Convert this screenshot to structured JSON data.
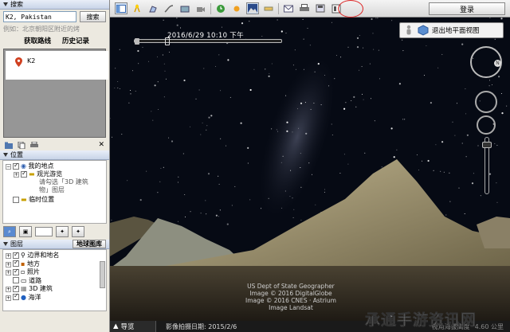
{
  "search": {
    "header": "搜索",
    "input_value": "K2, Pakistan",
    "search_button": "搜索",
    "example": "例如：北京朝阳区附近的烤",
    "get_route": "获取路线",
    "history": "历史记录",
    "result_label": "K2"
  },
  "places": {
    "header": "位置",
    "my_places": "我的地点",
    "sightseeing": "观光游览",
    "note_line1": "请勾选「3D 建筑",
    "note_line2": "物」图层",
    "temp_places": "临时位置"
  },
  "layers": {
    "header": "图层",
    "gallery_button": "地球图库",
    "items": [
      "边界和地名",
      "地方",
      "照片",
      "道路",
      "3D 建筑",
      "海洋"
    ]
  },
  "toolbar": {
    "login": "登录"
  },
  "view": {
    "exit_button": "退出地平面视图",
    "time_text": "2016/6/29  10:10 下午",
    "copyright": [
      "US Dept of State Geographer",
      "Image © 2016 DigitalGlobe",
      "Image © 2016 CNES · Astrium",
      "Image Landsat"
    ],
    "compass_label": "N"
  },
  "status": {
    "guide": "导览",
    "imagery_date": "影像拍摄日期: 2015/2/6",
    "elevation_label": "视角海拔高度",
    "elevation_value": "4.60 公里"
  },
  "watermark": "承通手游资讯网",
  "colors": {
    "sky": "#060a14",
    "highlight_circle": "#dd2222",
    "pin": "#d04020"
  }
}
